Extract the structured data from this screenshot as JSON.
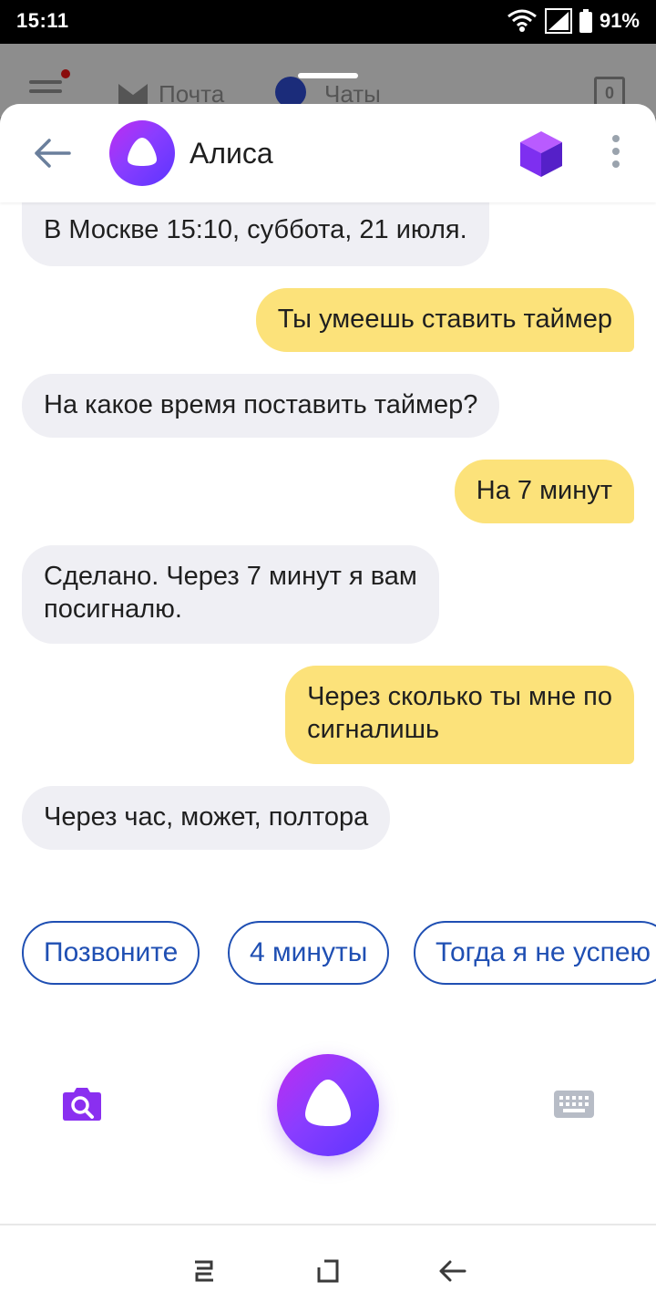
{
  "status_bar": {
    "time": "15:11",
    "battery": "91%",
    "icons": [
      "wifi-icon",
      "signal-icon",
      "battery-icon"
    ]
  },
  "background_app": {
    "mail_label": "Почта",
    "chats_label": "Чаты",
    "count": "0"
  },
  "header": {
    "title": "Алиса",
    "icons": [
      "back-arrow-icon",
      "alice-logo-icon",
      "cube-icon",
      "more-icon"
    ]
  },
  "messages": [
    {
      "from": "alice",
      "text": "В Москве 15:10, суббота, 21 июля."
    },
    {
      "from": "user",
      "text": "Ты умеешь ставить таймер"
    },
    {
      "from": "alice",
      "text": "На какое время поставить таймер?"
    },
    {
      "from": "user",
      "text": "На 7 минут"
    },
    {
      "from": "alice",
      "text": "Сделано. Через 7 минут я вам\nпосигналю."
    },
    {
      "from": "user",
      "text": "Через сколько ты мне по\nсигналишь"
    },
    {
      "from": "alice",
      "text": "Через час, может, полтора"
    }
  ],
  "suggestions": [
    "Позвоните",
    "4 минуты",
    "Тогда я не успею"
  ],
  "bottom_bar": {
    "icons": [
      "camera-search-icon",
      "alice-voice-icon",
      "keyboard-icon"
    ]
  },
  "nav_bar": {
    "icons": [
      "recent-apps-icon",
      "home-icon",
      "back-icon"
    ]
  },
  "colors": {
    "alice_bubble": "#efeff4",
    "user_bubble": "#fce27a",
    "chip_accent": "#1f4fb3",
    "alice_gradient_start": "#c02cf0",
    "alice_gradient_end": "#5b35ff"
  }
}
